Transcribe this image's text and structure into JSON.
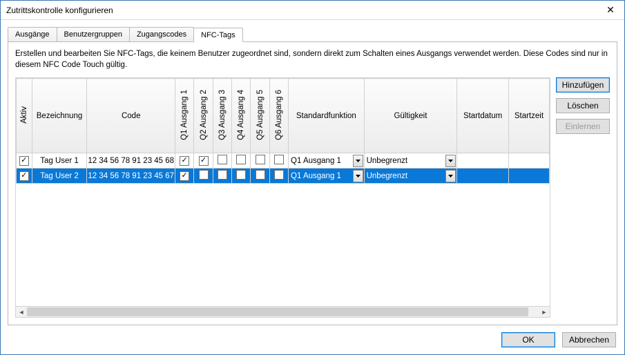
{
  "window": {
    "title": "Zutrittskontrolle konfigurieren"
  },
  "tabs": {
    "t0": "Ausgänge",
    "t1": "Benutzergruppen",
    "t2": "Zugangscodes",
    "t3": "NFC-Tags"
  },
  "description": "Erstellen und bearbeiten Sie NFC-Tags, die keinem Benutzer zugeordnet sind, sondern direkt zum Schalten eines Ausgangs verwendet werden. Diese Codes sind nur in diesem NFC Code Touch gültig.",
  "columns": {
    "aktiv": "Aktiv",
    "bezeichnung": "Bezeichnung",
    "code": "Code",
    "q1": "Q1 Ausgang 1",
    "q2": "Q2 Ausgang 2",
    "q3": "Q3 Ausgang 3",
    "q4": "Q4 Ausgang 4",
    "q5": "Q5 Ausgang 5",
    "q6": "Q6 Ausgang 6",
    "standard": "Standardfunktion",
    "gueltig": "Gültigkeit",
    "startdatum": "Startdatum",
    "startzeit": "Startzeit"
  },
  "rows": [
    {
      "aktiv": true,
      "bezeichnung": "Tag User 1",
      "code": "12 34 56 78 91 23 45 68",
      "q": [
        true,
        true,
        false,
        false,
        false,
        false
      ],
      "standard": "Q1 Ausgang 1",
      "gueltig": "Unbegrenzt",
      "startdatum": "",
      "startzeit": "",
      "selected": false
    },
    {
      "aktiv": true,
      "bezeichnung": "Tag User 2",
      "code": "12 34 56 78 91 23 45 67",
      "q": [
        true,
        false,
        false,
        false,
        false,
        false
      ],
      "standard": "Q1 Ausgang 1",
      "gueltig": "Unbegrenzt",
      "startdatum": "",
      "startzeit": "",
      "selected": true
    }
  ],
  "side": {
    "add": "Hinzufügen",
    "delete": "Löschen",
    "learn": "Einlernen"
  },
  "footer": {
    "ok": "OK",
    "cancel": "Abbrechen"
  }
}
